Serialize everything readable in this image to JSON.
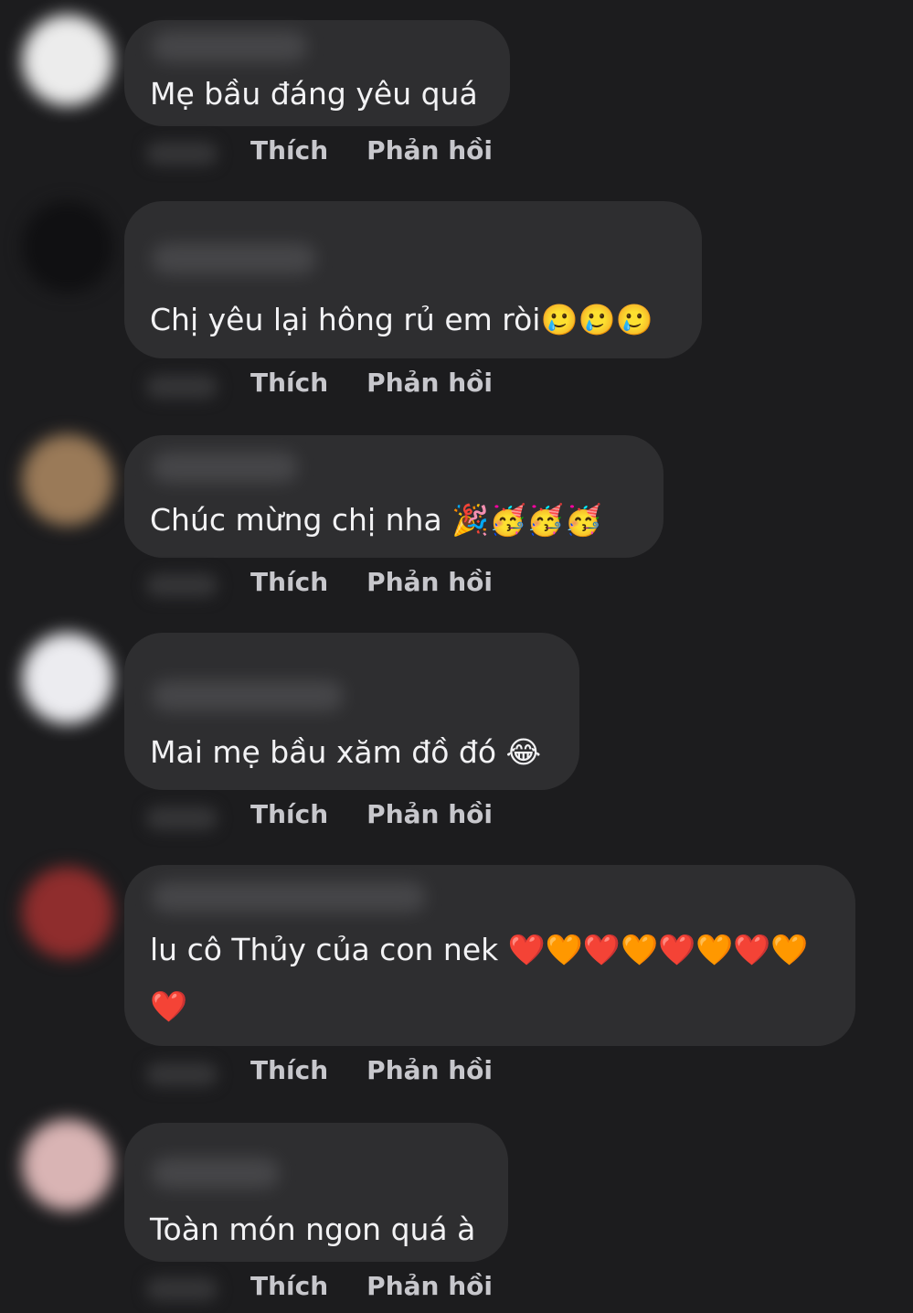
{
  "comments": [
    {
      "text": "Mẹ bầu đáng yêu quá",
      "like_label": "Thích",
      "reply_label": "Phản hồi",
      "avatar_color": "#ececec"
    },
    {
      "text": "Chị yêu lại hông rủ em ròi🥲🥲🥲",
      "like_label": "Thích",
      "reply_label": "Phản hồi",
      "avatar_color": "#101012"
    },
    {
      "text": "Chúc mừng chị nha 🎉🥳🥳🥳",
      "like_label": "Thích",
      "reply_label": "Phản hồi",
      "avatar_color": "#9a7a58"
    },
    {
      "text": "Mai mẹ bầu xăm đồ đó 😂",
      "like_label": "Thích",
      "reply_label": "Phản hồi",
      "avatar_color": "#ececf0"
    },
    {
      "text": "lu cô Thủy của con nek ❤️🧡❤️🧡❤️🧡❤️🧡❤️",
      "like_label": "Thích",
      "reply_label": "Phản hồi",
      "avatar_color": "#8f2d2d"
    },
    {
      "text": "Toàn món ngon quá à",
      "like_label": "Thích",
      "reply_label": "Phản hồi",
      "avatar_color": "#d9b4b4"
    }
  ]
}
